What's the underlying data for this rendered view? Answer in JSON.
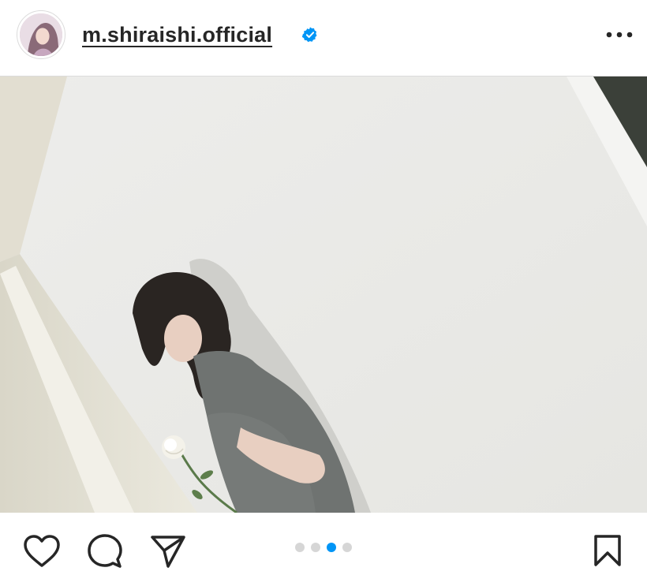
{
  "post": {
    "username": "m.shiraishi.official",
    "verified": true,
    "avatar_alt": "profile-photo",
    "more_icon": "more-horizontal-icon",
    "carousel": {
      "total": 4,
      "active_index": 2
    },
    "actions": {
      "like_icon": "heart-icon",
      "comment_icon": "comment-icon",
      "share_icon": "send-icon",
      "save_icon": "bookmark-icon"
    }
  },
  "colors": {
    "accent": "#0095f6",
    "text": "#262626",
    "divider": "#dbdbdb",
    "dot_inactive": "#d6d6d6"
  }
}
